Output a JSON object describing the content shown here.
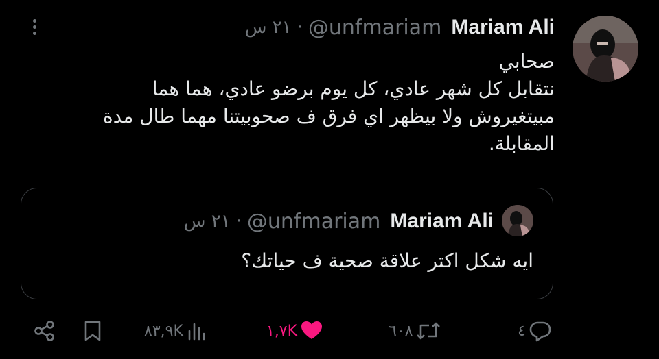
{
  "post": {
    "author_name": "Mariam Ali",
    "handle": "@unfmariam",
    "separator": "·",
    "time": "٢١ س",
    "text_lines": [
      "صحابي",
      "نتقابل كل شهر عادي، كل يوم برضو عادي، هما هما",
      "مبيتغيروش ولا بيظهر اي فرق ف صحوبيتنا مهما طال مدة",
      "المقابلة."
    ]
  },
  "quoted_post": {
    "author_name": "Mariam Ali",
    "handle": "@unfmariam",
    "separator": "·",
    "time": "٢١ س",
    "text": "ايه شكل اكتر علاقة صحية ف حياتك؟"
  },
  "actions": {
    "replies": "٤",
    "reposts": "٦٠٨",
    "likes": "١,٧K",
    "views": "٨٣,٩K"
  },
  "colors": {
    "background": "#000000",
    "primary_text": "#e7e9ea",
    "secondary_text": "#71767b",
    "like_active": "#f91880",
    "border": "#3a3d41"
  },
  "icons": [
    "more-icon",
    "reply-icon",
    "repost-icon",
    "heart-icon",
    "views-icon",
    "bookmark-icon",
    "share-icon"
  ]
}
